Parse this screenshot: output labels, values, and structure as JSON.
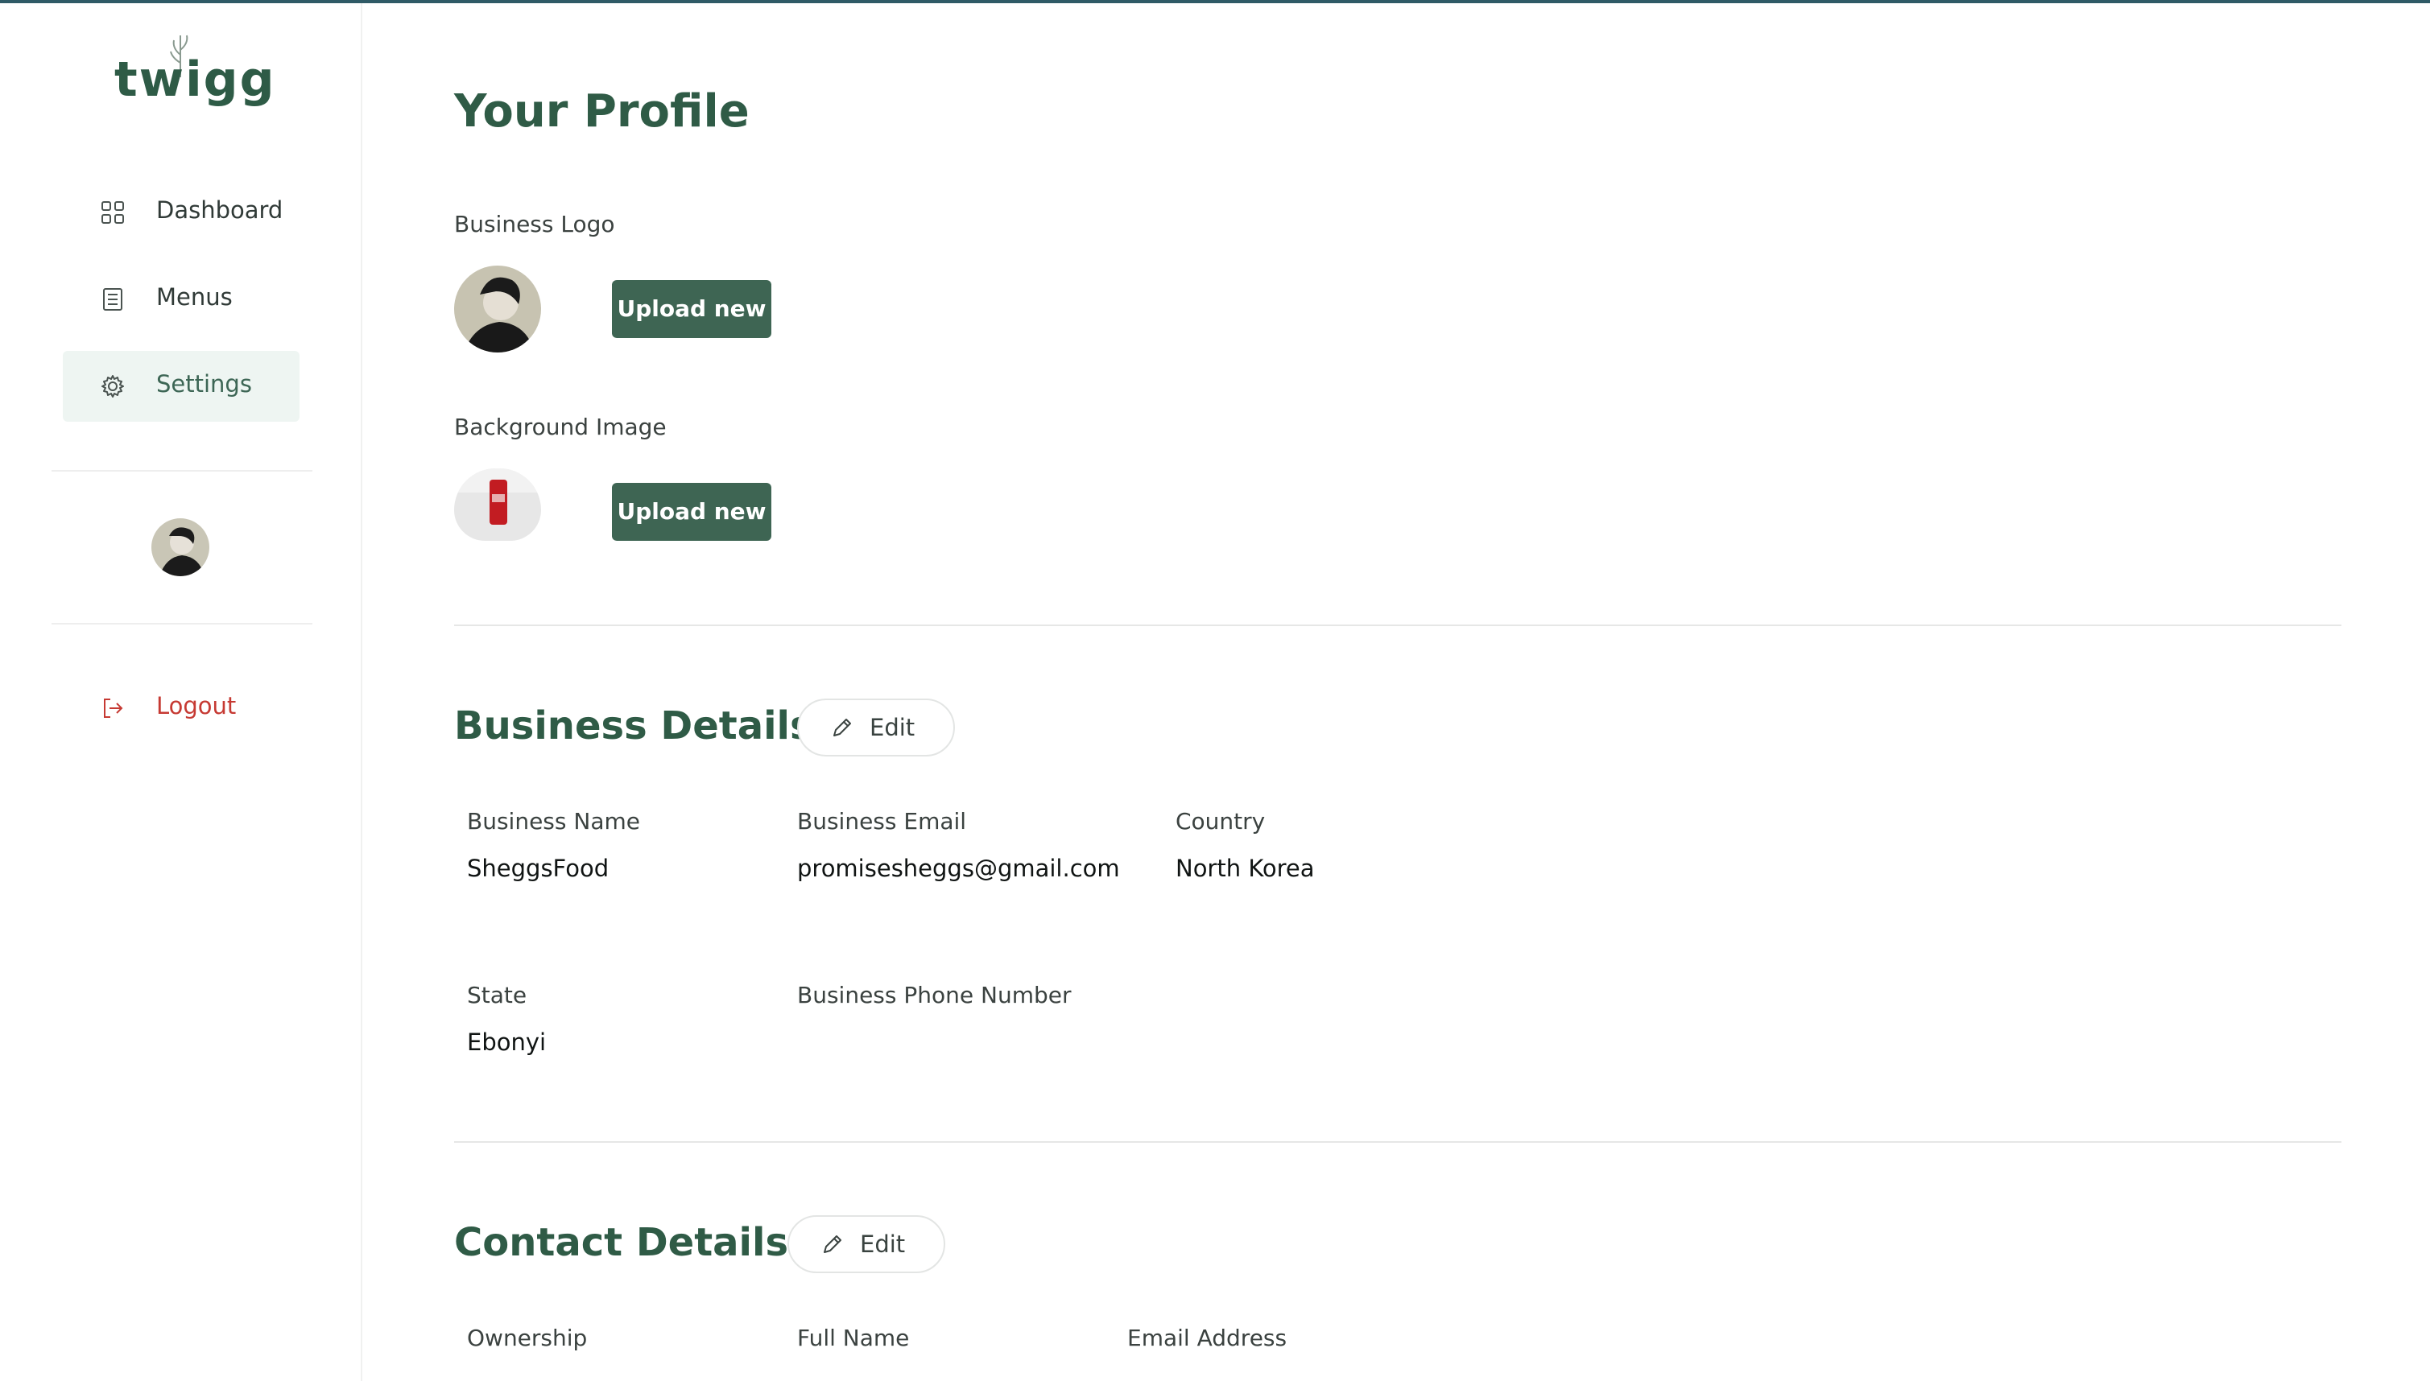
{
  "app": {
    "logo_text": "twigg"
  },
  "sidebar": {
    "items": [
      {
        "label": "Dashboard",
        "icon": "grid-icon"
      },
      {
        "label": "Menus",
        "icon": "document-icon"
      },
      {
        "label": "Settings",
        "icon": "gear-icon",
        "active": true
      }
    ],
    "logout_label": "Logout"
  },
  "profile": {
    "title": "Your Profile",
    "business_logo_label": "Business Logo",
    "background_image_label": "Background Image",
    "upload_label": "Upload new"
  },
  "business_details": {
    "title": "Business Details",
    "edit_label": "Edit",
    "fields": {
      "business_name": {
        "label": "Business Name",
        "value": "SheggsFood"
      },
      "business_email": {
        "label": "Business Email",
        "value": "promisesheggs@gmail.com"
      },
      "country": {
        "label": "Country",
        "value": "North Korea"
      },
      "state": {
        "label": "State",
        "value": "Ebonyi"
      },
      "phone": {
        "label": "Business Phone Number",
        "value": ""
      }
    }
  },
  "contact_details": {
    "title": "Contact Details",
    "edit_label": "Edit",
    "fields": {
      "ownership": {
        "label": "Ownership"
      },
      "full_name": {
        "label": "Full Name"
      },
      "email": {
        "label": "Email Address"
      }
    }
  },
  "colors": {
    "brand": "#2f5b46",
    "button": "#3e6553",
    "danger": "#c63a33",
    "active_bg": "#eef5f2"
  }
}
